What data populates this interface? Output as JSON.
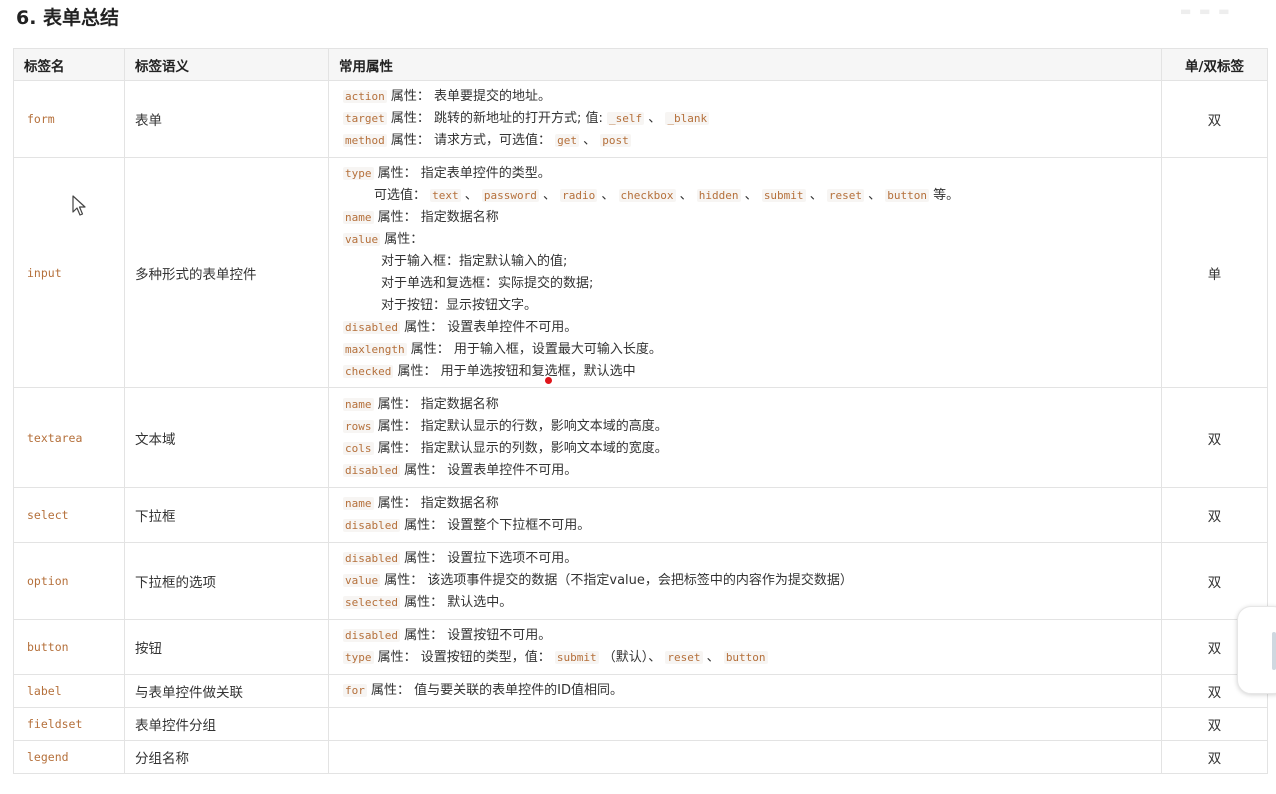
{
  "page_title": "6. 表单总结",
  "table": {
    "headers": [
      "标签名",
      "标签语义",
      "常用属性",
      "单/双标签"
    ],
    "rows": [
      {
        "tag": "form",
        "semantic": "表单",
        "kind": "双",
        "attrs": [
          {
            "indent": 0,
            "parts": [
              {
                "c": true,
                "t": "action"
              },
              {
                "t": " 属性： 表单要提交的地址。"
              }
            ]
          },
          {
            "indent": 0,
            "parts": [
              {
                "c": true,
                "t": "target"
              },
              {
                "t": " 属性： 跳转的新地址的打开方式; 值: "
              },
              {
                "c": true,
                "t": "_self"
              },
              {
                "t": " 、 "
              },
              {
                "c": true,
                "t": "_blank"
              }
            ]
          },
          {
            "indent": 0,
            "parts": [
              {
                "c": true,
                "t": "method"
              },
              {
                "t": " 属性： 请求方式，可选值： "
              },
              {
                "c": true,
                "t": "get"
              },
              {
                "t": " 、 "
              },
              {
                "c": true,
                "t": "post"
              }
            ]
          }
        ]
      },
      {
        "tag": "input",
        "semantic": "多种形式的表单控件",
        "kind": "单",
        "attrs": [
          {
            "indent": 0,
            "parts": [
              {
                "c": true,
                "t": "type"
              },
              {
                "t": " 属性： 指定表单控件的类型。"
              }
            ]
          },
          {
            "indent": 1,
            "parts": [
              {
                "t": "可选值： "
              },
              {
                "c": true,
                "t": "text"
              },
              {
                "t": " 、 "
              },
              {
                "c": true,
                "t": "password"
              },
              {
                "t": " 、 "
              },
              {
                "c": true,
                "t": "radio"
              },
              {
                "t": " 、 "
              },
              {
                "c": true,
                "t": "checkbox"
              },
              {
                "t": " 、 "
              },
              {
                "c": true,
                "t": "hidden"
              },
              {
                "t": " 、 "
              },
              {
                "c": true,
                "t": "submit"
              },
              {
                "t": " 、 "
              },
              {
                "c": true,
                "t": "reset"
              },
              {
                "t": " 、 "
              },
              {
                "c": true,
                "t": "button"
              },
              {
                "t": " 等。"
              }
            ]
          },
          {
            "indent": 0,
            "parts": [
              {
                "c": true,
                "t": "name"
              },
              {
                "t": " 属性： 指定数据名称"
              }
            ]
          },
          {
            "indent": 0,
            "parts": [
              {
                "c": true,
                "t": "value"
              },
              {
                "t": " 属性："
              }
            ]
          },
          {
            "indent": 2,
            "parts": [
              {
                "t": "对于输入框：指定默认输入的值;"
              }
            ]
          },
          {
            "indent": 2,
            "parts": [
              {
                "t": "对于单选和复选框：实际提交的数据;"
              }
            ]
          },
          {
            "indent": 2,
            "parts": [
              {
                "t": "对于按钮：显示按钮文字。"
              }
            ]
          },
          {
            "indent": 0,
            "parts": [
              {
                "c": true,
                "t": "disabled"
              },
              {
                "t": " 属性： 设置表单控件不可用。"
              }
            ]
          },
          {
            "indent": 0,
            "parts": [
              {
                "c": true,
                "t": "maxlength"
              },
              {
                "t": " 属性： 用于输入框，设置最大可输入长度。"
              }
            ]
          },
          {
            "indent": 0,
            "parts": [
              {
                "c": true,
                "t": "checked"
              },
              {
                "t": " 属性： 用于单选按钮和复选框，默认选中"
              }
            ]
          }
        ]
      },
      {
        "tag": "textarea",
        "semantic": "文本域",
        "kind": "双",
        "attrs": [
          {
            "indent": 0,
            "parts": [
              {
                "c": true,
                "t": "name"
              },
              {
                "t": " 属性： 指定数据名称"
              }
            ]
          },
          {
            "indent": 0,
            "parts": [
              {
                "c": true,
                "t": "rows"
              },
              {
                "t": " 属性： 指定默认显示的行数，影响文本域的高度。"
              }
            ]
          },
          {
            "indent": 0,
            "parts": [
              {
                "c": true,
                "t": "cols"
              },
              {
                "t": " 属性： 指定默认显示的列数，影响文本域的宽度。"
              }
            ]
          },
          {
            "indent": 0,
            "parts": [
              {
                "c": true,
                "t": "disabled"
              },
              {
                "t": " 属性： 设置表单控件不可用。"
              }
            ]
          }
        ]
      },
      {
        "tag": "select",
        "semantic": "下拉框",
        "kind": "双",
        "attrs": [
          {
            "indent": 0,
            "parts": [
              {
                "c": true,
                "t": "name"
              },
              {
                "t": " 属性： 指定数据名称"
              }
            ]
          },
          {
            "indent": 0,
            "parts": [
              {
                "c": true,
                "t": "disabled"
              },
              {
                "t": " 属性： 设置整个下拉框不可用。"
              }
            ]
          }
        ]
      },
      {
        "tag": "option",
        "semantic": "下拉框的选项",
        "kind": "双",
        "attrs": [
          {
            "indent": 0,
            "parts": [
              {
                "c": true,
                "t": "disabled"
              },
              {
                "t": " 属性： 设置拉下选项不可用。"
              }
            ]
          },
          {
            "indent": 0,
            "parts": [
              {
                "c": true,
                "t": "value"
              },
              {
                "t": " 属性： 该选项事件提交的数据（不指定value，会把标签中的内容作为提交数据）"
              }
            ]
          },
          {
            "indent": 0,
            "parts": [
              {
                "c": true,
                "t": "selected"
              },
              {
                "t": " 属性： 默认选中。"
              }
            ]
          }
        ]
      },
      {
        "tag": "button",
        "semantic": "按钮",
        "kind": "双",
        "attrs": [
          {
            "indent": 0,
            "parts": [
              {
                "c": true,
                "t": "disabled"
              },
              {
                "t": " 属性： 设置按钮不可用。"
              }
            ]
          },
          {
            "indent": 0,
            "parts": [
              {
                "c": true,
                "t": "type"
              },
              {
                "t": " 属性： 设置按钮的类型，值： "
              },
              {
                "c": true,
                "t": "submit"
              },
              {
                "t": " （默认）、 "
              },
              {
                "c": true,
                "t": "reset"
              },
              {
                "t": " 、 "
              },
              {
                "c": true,
                "t": "button"
              }
            ]
          }
        ]
      },
      {
        "tag": "label",
        "semantic": "与表单控件做关联",
        "kind": "双",
        "attrs": [
          {
            "indent": 0,
            "parts": [
              {
                "c": true,
                "t": "for"
              },
              {
                "t": " 属性： 值与要关联的表单控件的ID值相同。"
              }
            ]
          }
        ]
      },
      {
        "tag": "fieldset",
        "semantic": "表单控件分组",
        "kind": "双",
        "attrs": []
      },
      {
        "tag": "legend",
        "semantic": "分组名称",
        "kind": "双",
        "attrs": []
      }
    ]
  }
}
